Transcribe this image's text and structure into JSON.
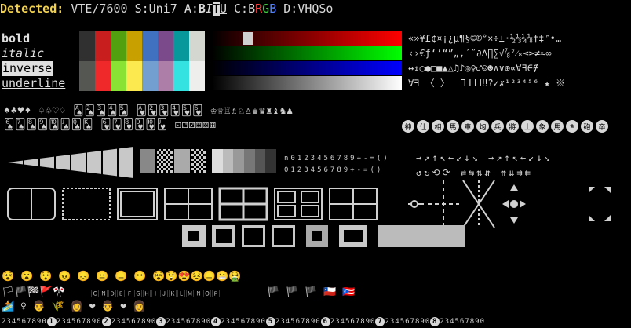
{
  "header": {
    "label": "Detected:",
    "vte": "VTE/7600",
    "s": "S:Uni7",
    "a_prefix": "A:",
    "a_b": "B",
    "a_i": "I",
    "a_t": "T",
    "a_u": "U",
    "c_prefix": "C:",
    "c_b": "B",
    "c_r": "R",
    "c_g": "G",
    "c_b2": "B",
    "d": "D:VHQSo"
  },
  "styles": {
    "bold": "bold",
    "italic": "italic",
    "inverse": "inverse",
    "underline": "underline"
  },
  "palette": {
    "row1": [
      "#303030",
      "#c81e1e",
      "#52a010",
      "#c8a000",
      "#4070c0",
      "#7a4a8a",
      "#06989a",
      "#d3d7cf"
    ],
    "row2": [
      "#303030",
      "#c81e1e",
      "#52a010",
      "#c8a000",
      "#4070c0",
      "#7a4a8a",
      "#06989a",
      "#d3d7cf"
    ],
    "row3": [
      "#555753",
      "#ef2929",
      "#8ae234",
      "#fce94f",
      "#729fcf",
      "#ad7fa8",
      "#34e2e2",
      "#eeeeec"
    ],
    "row4": [
      "#555753",
      "#ef2929",
      "#8ae234",
      "#fce94f",
      "#729fcf",
      "#ad7fa8",
      "#34e2e2",
      "#eeeeec"
    ]
  },
  "symbols": {
    "line1": "«»¥£¢¤¡¿µ¶§©®°×÷±·½⅓¼⅛†‡™•…",
    "line2": "‹›€ƒ‘’“”„‚´˝∂∆∏∑√⅞⁷⁄₈≤≥≠≈∞",
    "line3": "↔↕○●□■▲△♫♪◎♀♂☺☻∧∨⊕∝∀∃∈∉",
    "line4": "∀∃ 〈 〉  ⅂⅃⅃⅃‼?✓✗¹²³⁴⁵⁶ ★ ※"
  },
  "cards": {
    "row1": "♠♣♥♦ ♤♧♡♢ 🂡🂢🂣🂤🂥 🂱🂲🂳🂴🂵🂶 ♔♕♖♗♘♙♚♛♜♝♞♟",
    "row2": "🂦🂧🂨🂩🂪🂫🂭🂮 🂶🂷🂸🂹🂺🂻 ⚀⚁⚂⚃⚄⚅"
  },
  "mahjong": [
    "神",
    "仕",
    "相",
    "馬",
    "車",
    "炮",
    "兵",
    "將",
    "士",
    "象",
    "馬",
    "❀",
    "砲",
    "卒"
  ],
  "digits_row": "n0123456789+-=()",
  "digits_row2": "0123456789+-=()",
  "arrows1": "→↗↑↖←↙↓↘ →↗↑↖←↙↓↘",
  "arrows2": "↺↻⟲⟳ ⇄⇆⇅⇵ ⇈⇊⇉⇇",
  "faces": "😵 😮 😯 😠 😞 😐 😑 😶",
  "faces2": "😵😲😍😣😑😬🤮",
  "flags_text": "🏳🏴🏁🚩🎌",
  "band_text": "🄲🄽🄳🄴🄵🄶🄷🄸🄹🄺🄻🄼🄽🄾🄿",
  "flags_right": "🏴 🏴 🏴 🇨🇱 🇵🇷",
  "emoji_row": "🏄 ♀ 👨 🌾 👩 ❤ 👨 ❤ 👩",
  "numbers": "1234567890",
  "circled": [
    "1",
    "2",
    "3",
    "4",
    "5",
    "6",
    "7",
    "8"
  ]
}
